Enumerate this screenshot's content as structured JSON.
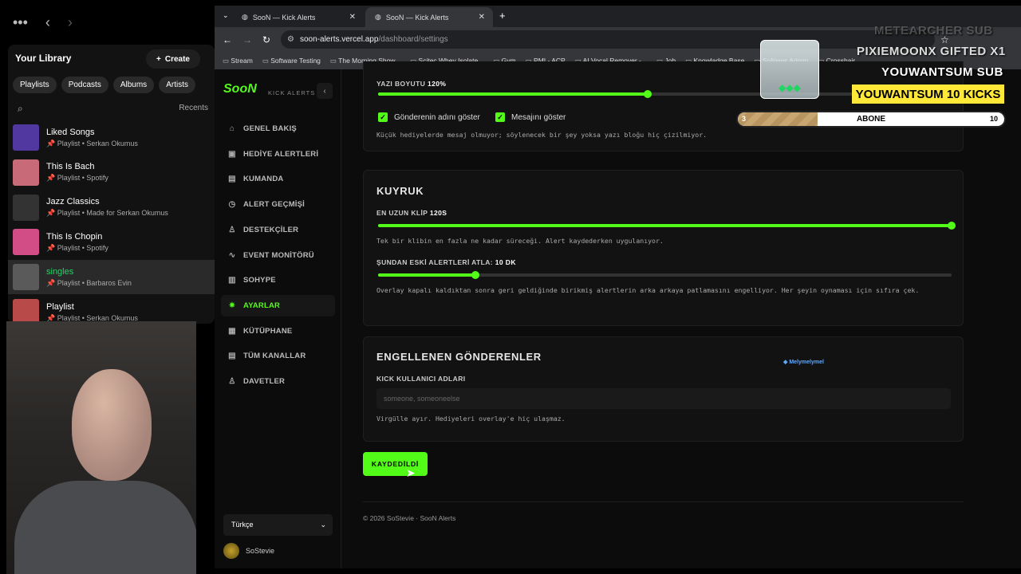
{
  "spotify": {
    "library_title": "Your Library",
    "create_label": "Create",
    "chips": [
      "Playlists",
      "Podcasts",
      "Albums",
      "Artists"
    ],
    "recents_label": "Recents",
    "playlists": [
      {
        "name": "Liked Songs",
        "sub": "Playlist • Serkan Okumus",
        "color": "#5038a0"
      },
      {
        "name": "This Is Bach",
        "sub": "Playlist • Spotify",
        "color": "#c96a78"
      },
      {
        "name": "Jazz Classics",
        "sub": "Playlist • Made for Serkan Okumus",
        "color": "#333333"
      },
      {
        "name": "This Is Chopin",
        "sub": "Playlist • Spotify",
        "color": "#d24c86"
      },
      {
        "name": "singles",
        "sub": "Playlist • Barbaros Evin",
        "color": "#5a5a5a"
      },
      {
        "name": "Playlist",
        "sub": "Playlist • Serkan Okumus",
        "color": "#b84a4a"
      }
    ]
  },
  "browser": {
    "tabs": [
      "SooN — Kick Alerts",
      "SooN — Kick Alerts"
    ],
    "url_host": "soon-alerts.vercel.app",
    "url_path": "/dashboard/settings",
    "bookmarks": [
      "Stream",
      "Software Testing",
      "The Morning Show...",
      "Scitec Whey Isolate...",
      "Gym",
      "PMI - ACP",
      "AI Vocal Remover -...",
      "Job",
      "Knowladge Base",
      "SoNews Admin",
      "Crosshair"
    ]
  },
  "app": {
    "logo": "SooN",
    "logo_sub": "KICK ALERTS",
    "nav": [
      {
        "label": "GENEL BAKIŞ",
        "icon": "⌂"
      },
      {
        "label": "HEDİYE ALERTLERİ",
        "icon": "▣"
      },
      {
        "label": "KUMANDA",
        "icon": "▤"
      },
      {
        "label": "ALERT GEÇMİŞİ",
        "icon": "◷"
      },
      {
        "label": "DESTEKÇİLER",
        "icon": "♙"
      },
      {
        "label": "EVENT MONİTÖRÜ",
        "icon": "∿"
      },
      {
        "label": "SOHYPE",
        "icon": "▥"
      },
      {
        "label": "AYARLAR",
        "icon": "✷"
      },
      {
        "label": "KÜTÜPHANE",
        "icon": "▦"
      },
      {
        "label": "TÜM KANALLAR",
        "icon": "▤"
      },
      {
        "label": "DAVETLER",
        "icon": "♙"
      }
    ],
    "language": "Türkçe",
    "username": "SoStevie",
    "text_size_label": "YAZI BOYUTU",
    "text_size_value": "120%",
    "text_size_fraction": 0.47,
    "show_sender_label": "Gönderenin adını göster",
    "show_message_label": "Mesajını göster",
    "small_gift_help": "Küçük hediyelerde mesaj olmuyor; söylenecek bir şey yoksa yazı bloğu hiç çizilmiyor.",
    "queue_title": "KUYRUK",
    "longest_clip_label": "EN UZUN KLİP",
    "longest_clip_value": "120S",
    "longest_clip_fraction": 1.0,
    "longest_clip_help": "Tek bir klibin en fazla ne kadar süreceği. Alert kaydederken uygulanıyor.",
    "skip_older_label": "ŞUNDAN ESKİ ALERTLERİ ATLA:",
    "skip_older_value": "10 DK",
    "skip_older_fraction": 0.17,
    "skip_older_help": "Overlay kapalı kaldıktan sonra geri geldiğinde birikmiş alertlerin arka arkaya patlamasını engelliyor. Her şeyin oynaması için sıfıra çek.",
    "blocked_title": "ENGELLENEN GÖNDERENLER",
    "kick_usernames_label": "KICK KULLANICI ADLARI",
    "blocked_placeholder": "someone, someoneelse",
    "blocked_help": "Virgülle ayır. Hediyeleri overlay'e hiç ulaşmaz.",
    "save_label": "KAYDEDİLDİ",
    "footer": "© 2026 SoStevie · SooN Alerts",
    "accent": "#53fc18"
  },
  "overlay": {
    "faded_text": "METEARCHER SUB",
    "line1": "PIXIEMOONX  GIFTED X1",
    "line2": "YOUWANTSUM  SUB",
    "line3": "YOUWANTSUM  10 KICKS",
    "goal_label": "ABONE",
    "goal_current": "3",
    "goal_target": "10",
    "goal_fraction": 0.3,
    "chat_user": "Melymelymel"
  }
}
